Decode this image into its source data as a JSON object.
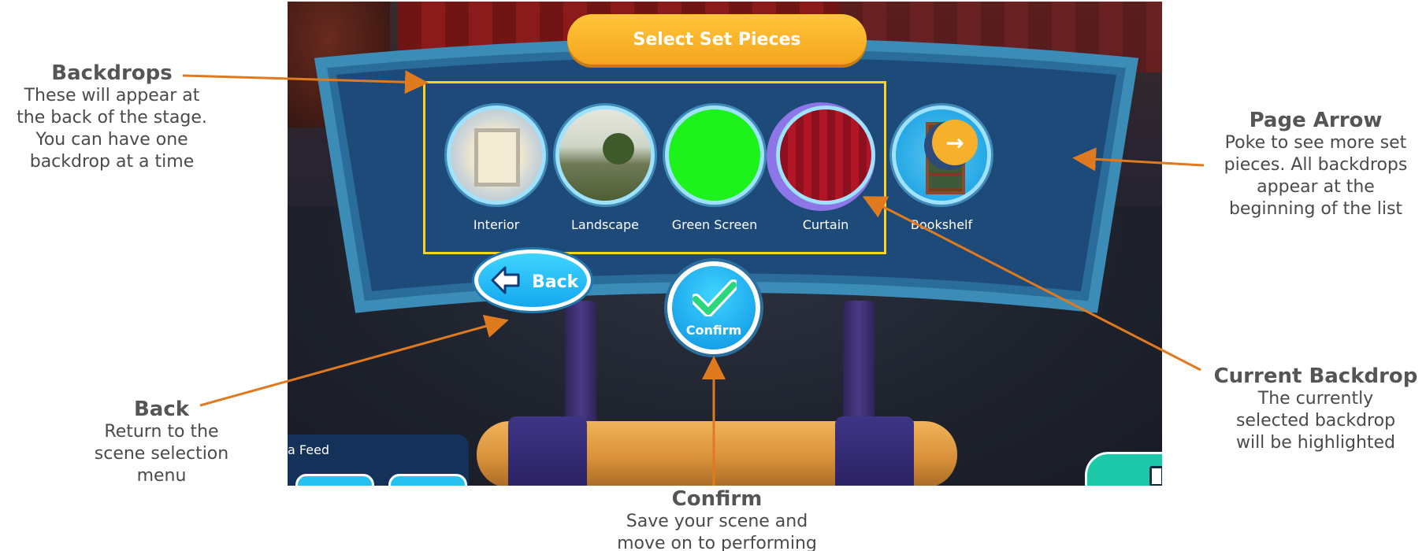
{
  "screenshot": {
    "title": "Select Set Pieces",
    "items": [
      {
        "label": "Interior",
        "thumbnail": "interior-backdrop"
      },
      {
        "label": "Landscape",
        "thumbnail": "landscape-backdrop"
      },
      {
        "label": "Green Screen",
        "thumbnail": "green-screen-backdrop"
      },
      {
        "label": "Curtain",
        "thumbnail": "curtain-backdrop",
        "selected": true
      },
      {
        "label": "Bookshelf",
        "thumbnail": "bookshelf-set-piece"
      }
    ],
    "page_arrow_icon": "arrow-right-icon",
    "back_label": "Back",
    "confirm_label": "Confirm",
    "feed_label": "a Feed",
    "colors": {
      "title_pill": "#f5a51e",
      "selection_box": "#ffd21f",
      "button_blue": "#14a8ef",
      "annotation_arrow": "#e07a1f"
    }
  },
  "annotations": {
    "backdrops": {
      "title": "Backdrops",
      "lines": [
        "These will appear at",
        "the back of the stage.",
        "You can have one",
        "backdrop at a time"
      ]
    },
    "page_arrow": {
      "title": "Page Arrow",
      "lines": [
        "Poke to see more set",
        "pieces. All backdrops",
        "appear at the",
        "beginning of the list"
      ]
    },
    "current_backdrop": {
      "title": "Current Backdrop",
      "lines": [
        "The currently",
        "selected backdrop",
        "will be highlighted"
      ]
    },
    "back": {
      "title": "Back",
      "lines": [
        "Return to the",
        "scene selection",
        "menu"
      ]
    },
    "confirm": {
      "title": "Confirm",
      "lines": [
        "Save your scene and",
        "move on to performing"
      ]
    }
  }
}
